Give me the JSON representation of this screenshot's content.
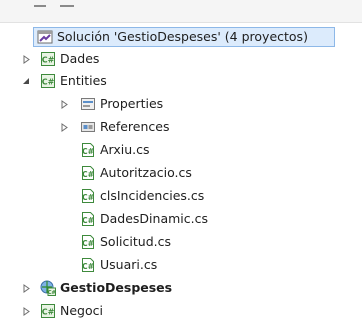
{
  "solution": {
    "label": "Solución 'GestioDespeses' (4 proyectos)"
  },
  "tree": {
    "dades": {
      "label": "Dades"
    },
    "entities": {
      "label": "Entities",
      "properties": "Properties",
      "references": "References",
      "files": [
        "Arxiu.cs",
        "Autoritzacio.cs",
        "clsIncidencies.cs",
        "DadesDinamic.cs",
        "Solicitud.cs",
        "Usuari.cs"
      ]
    },
    "gestio": {
      "label": "GestioDespeses"
    },
    "negoci": {
      "label": "Negoci"
    }
  },
  "icons": {
    "solution": "solution-icon",
    "csproj": "csharp-project-icon",
    "properties": "properties-icon",
    "references": "references-icon",
    "csfile": "csharp-file-icon",
    "webproj": "web-project-icon"
  },
  "colors": {
    "selection_fill": "#dcebfc",
    "selection_border": "#8db8e8",
    "csharp_green": "#3e8a3c"
  }
}
